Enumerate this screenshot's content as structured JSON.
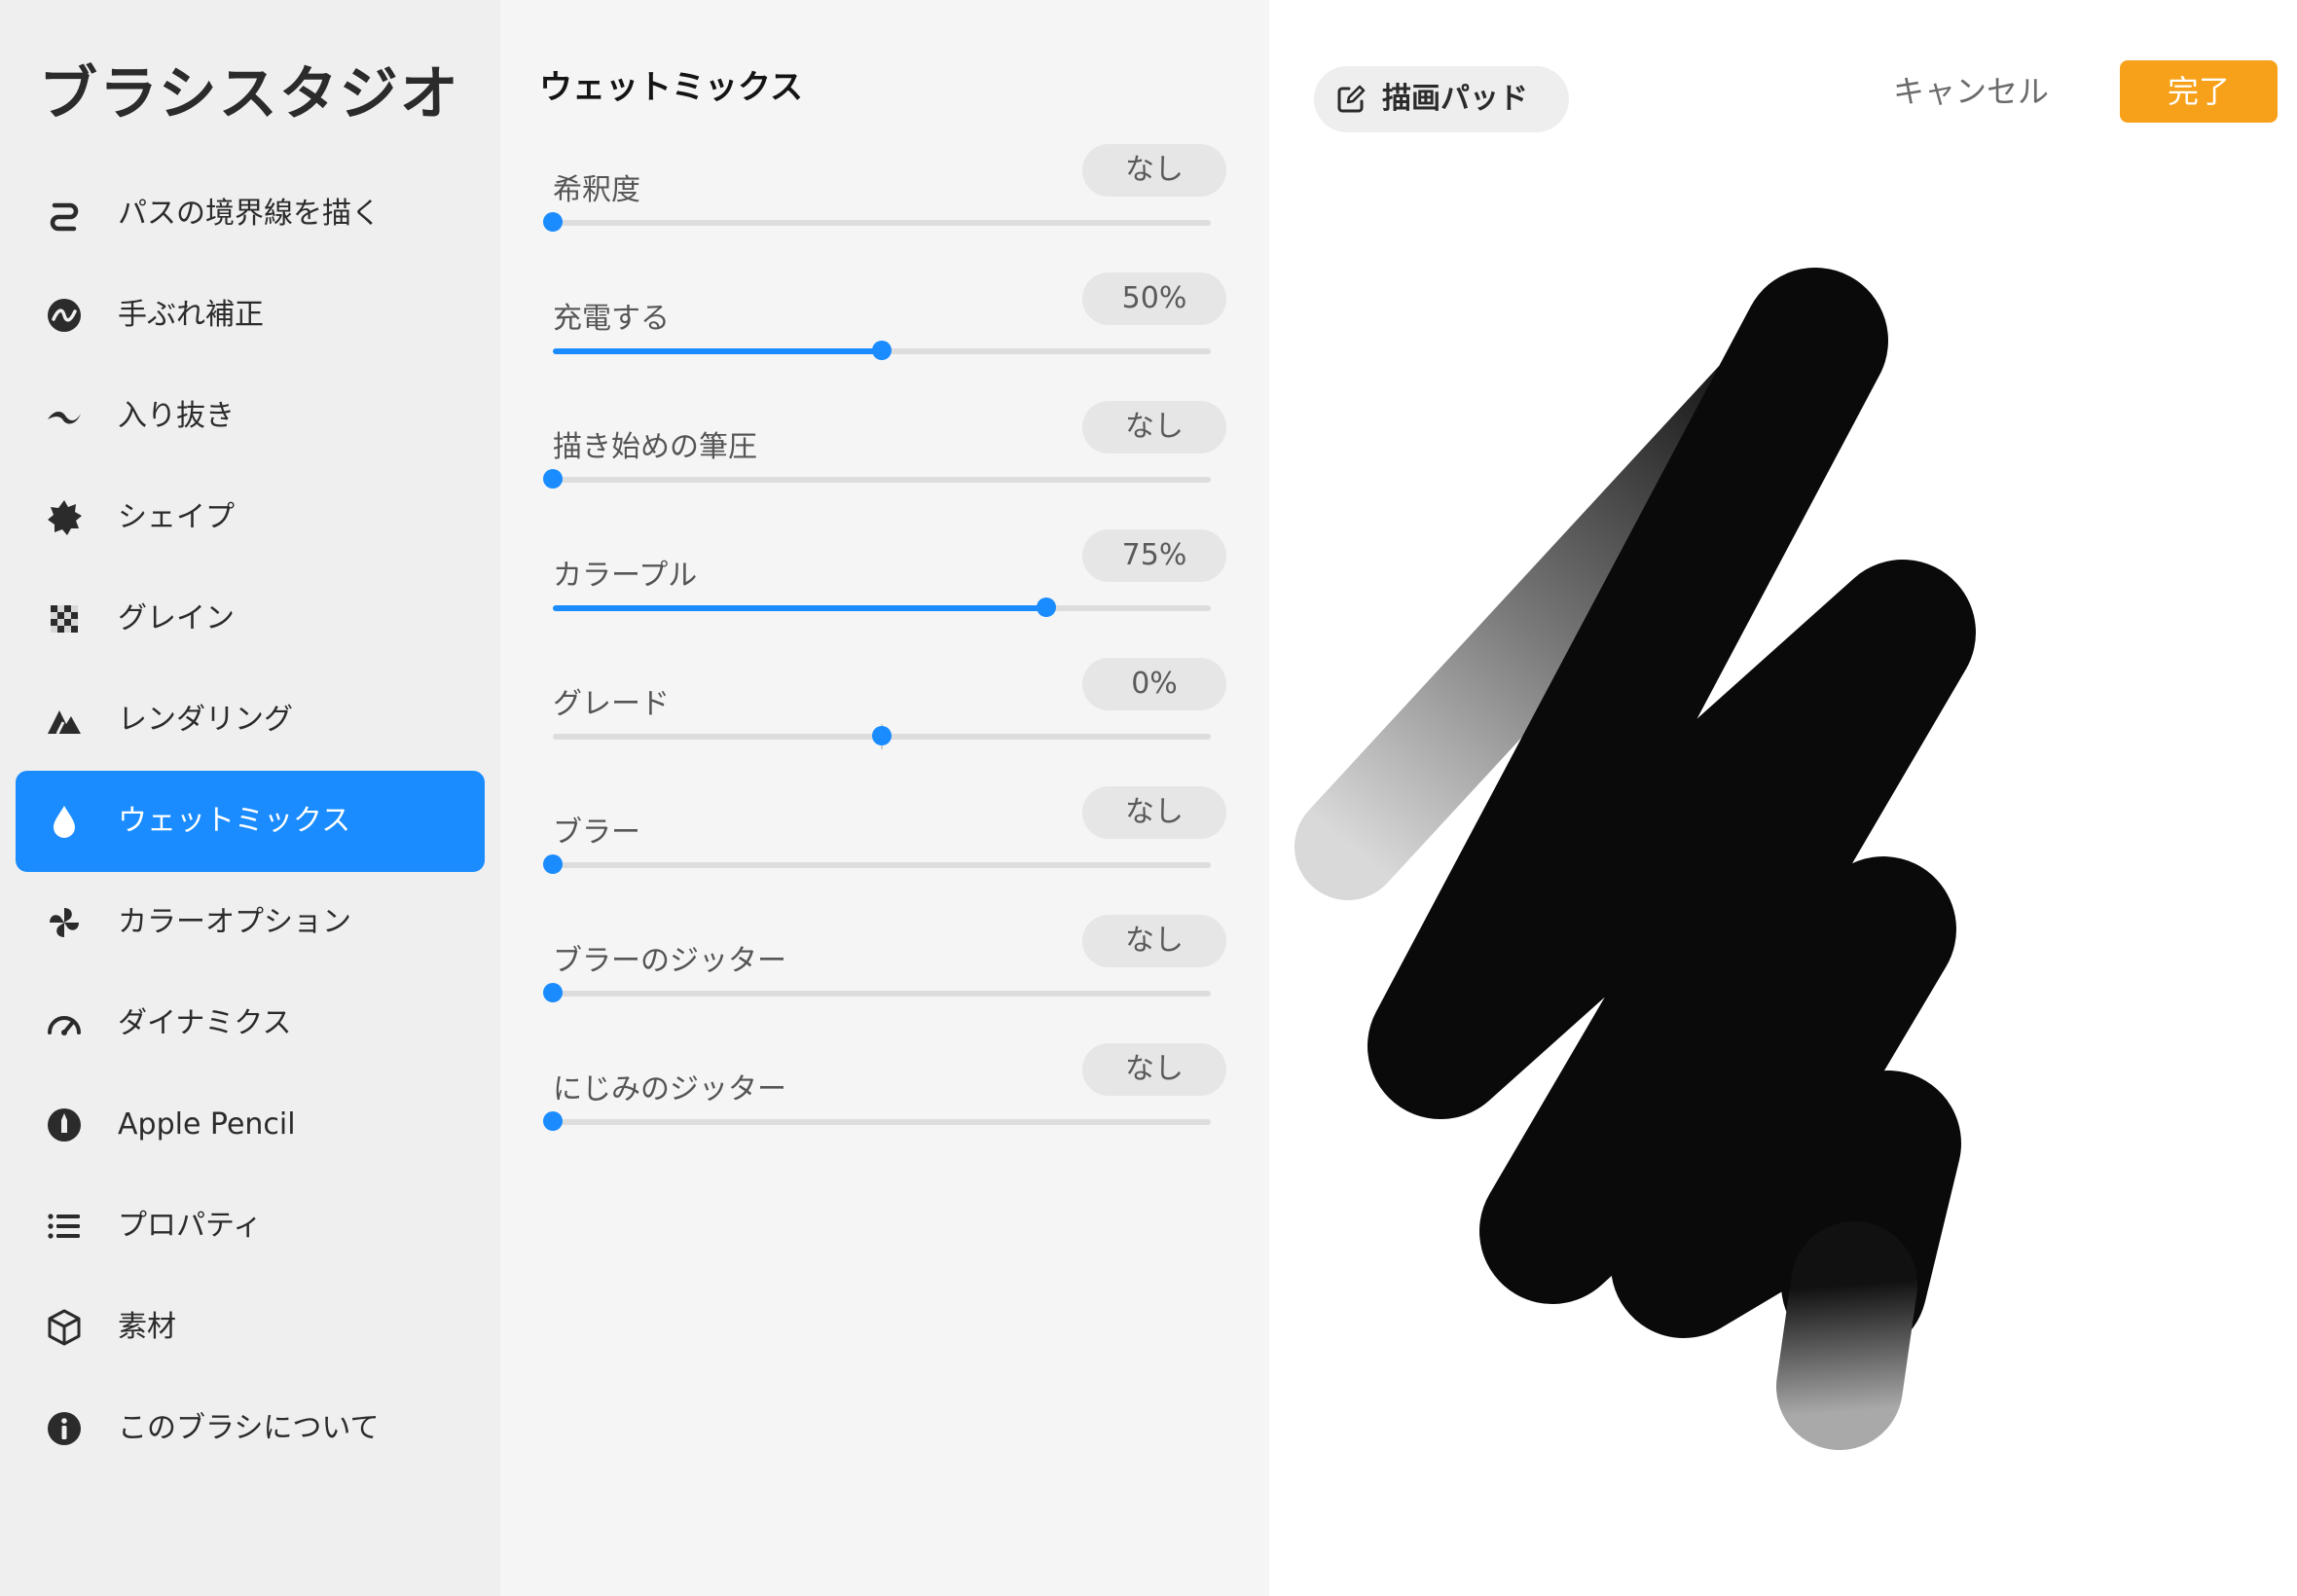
{
  "app": {
    "title": "ブラシスタジオ"
  },
  "sidebar": {
    "active_index": 6,
    "accent_color": "#1a8cff",
    "items": [
      {
        "label": "パスの境界線を描く",
        "icon": "stroke-path-icon"
      },
      {
        "label": "手ぶれ補正",
        "icon": "stabilization-icon"
      },
      {
        "label": "入り抜き",
        "icon": "taper-icon"
      },
      {
        "label": "シェイプ",
        "icon": "shape-icon"
      },
      {
        "label": "グレイン",
        "icon": "grain-icon"
      },
      {
        "label": "レンダリング",
        "icon": "rendering-icon"
      },
      {
        "label": "ウェットミックス",
        "icon": "droplet-icon"
      },
      {
        "label": "カラーオプション",
        "icon": "pinwheel-icon"
      },
      {
        "label": "ダイナミクス",
        "icon": "speedometer-icon"
      },
      {
        "label": "Apple Pencil",
        "icon": "pencil-icon"
      },
      {
        "label": "プロパティ",
        "icon": "list-icon"
      },
      {
        "label": "素材",
        "icon": "cube-icon"
      },
      {
        "label": "このブラシについて",
        "icon": "info-icon"
      }
    ]
  },
  "panel": {
    "section_title": "ウェットミックス",
    "settings": [
      {
        "label": "希釈度",
        "value_text": "なし",
        "level": 0.0
      },
      {
        "label": "充電する",
        "value_text": "50%",
        "level": 0.5
      },
      {
        "label": "描き始めの筆圧",
        "value_text": "なし",
        "level": 0.0
      },
      {
        "label": "カラープル",
        "value_text": "75%",
        "level": 0.75
      },
      {
        "label": "グレード",
        "value_text": "0%",
        "level": 0.5,
        "centered": true
      },
      {
        "label": "ブラー",
        "value_text": "なし",
        "level": 0.0
      },
      {
        "label": "ブラーのジッター",
        "value_text": "なし",
        "level": 0.0
      },
      {
        "label": "にじみのジッター",
        "value_text": "なし",
        "level": 0.0
      }
    ]
  },
  "toolbar": {
    "drawing_pad_label": "描画パッド",
    "cancel_label": "キャンセル",
    "done_label": "完了",
    "done_color": "#f7a11a"
  }
}
